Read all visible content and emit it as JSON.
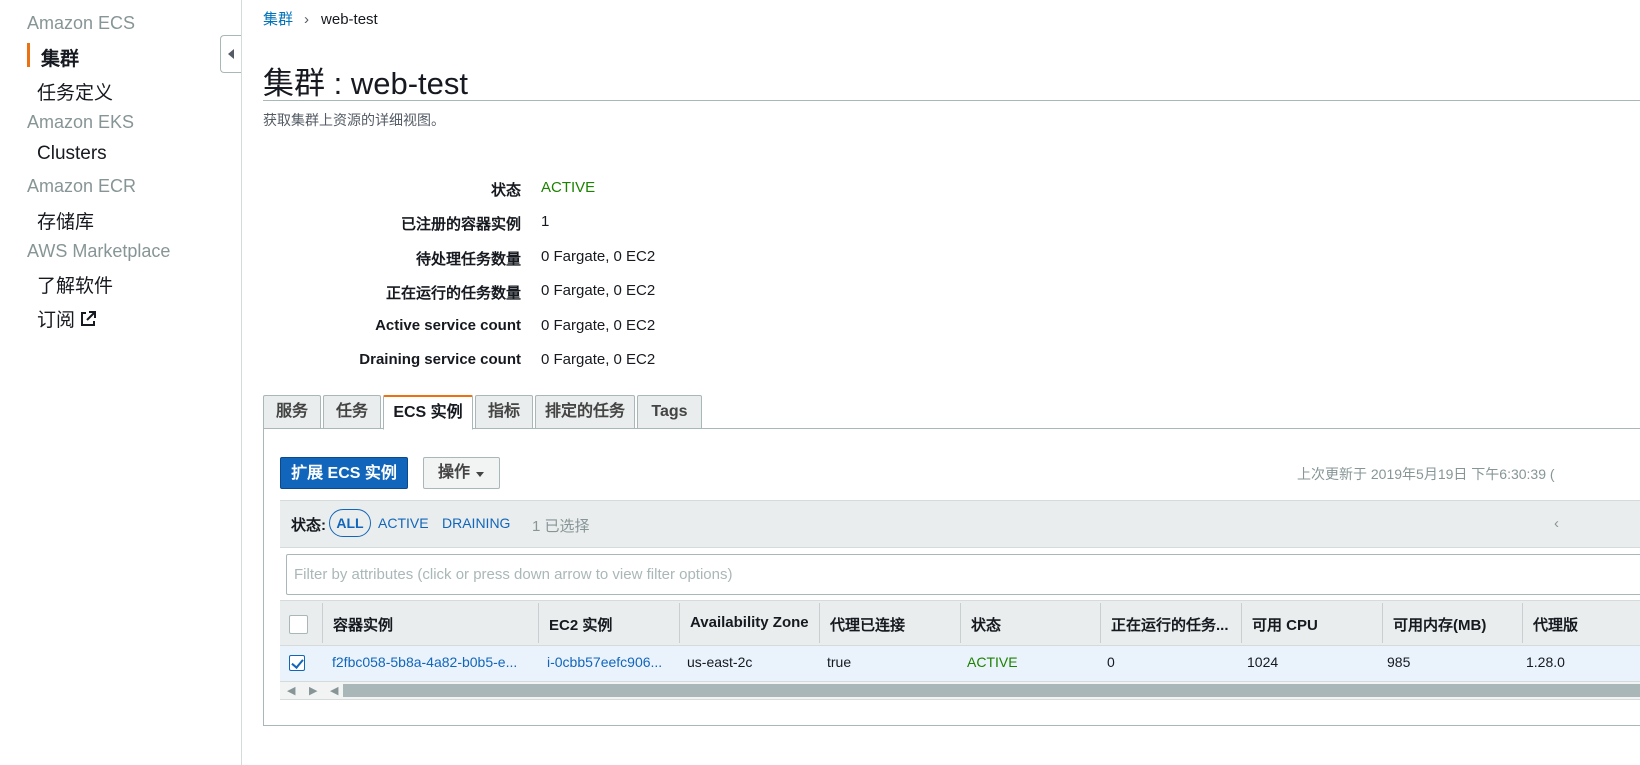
{
  "sidebar": {
    "sections": [
      {
        "title": "Amazon ECS",
        "items": [
          "集群",
          "任务定义"
        ]
      },
      {
        "title": "Amazon EKS",
        "items": [
          "Clusters"
        ]
      },
      {
        "title": "Amazon ECR",
        "items": [
          "存储库"
        ]
      },
      {
        "title": "AWS Marketplace",
        "items": [
          "了解软件",
          "订阅"
        ]
      }
    ],
    "active_item": "集群",
    "external_link_icon": "external-link-icon"
  },
  "breadcrumb": {
    "root": "集群",
    "current": "web-test"
  },
  "page": {
    "title": "集群 : web-test",
    "subtitle": "获取集群上资源的详细视图。"
  },
  "details": [
    {
      "label": "状态",
      "value": "ACTIVE"
    },
    {
      "label": "已注册的容器实例",
      "value": "1"
    },
    {
      "label": "待处理任务数量",
      "value": "0 Fargate, 0 EC2"
    },
    {
      "label": "正在运行的任务数量",
      "value": "0 Fargate, 0 EC2"
    },
    {
      "label": "Active service count",
      "value": "0 Fargate, 0 EC2"
    },
    {
      "label": "Draining service count",
      "value": "0 Fargate, 0 EC2"
    }
  ],
  "tabs": [
    {
      "label": "服务"
    },
    {
      "label": "任务"
    },
    {
      "label": "ECS 实例"
    },
    {
      "label": "指标"
    },
    {
      "label": "排定的任务"
    },
    {
      "label": "Tags"
    }
  ],
  "selected_tab": "ECS 实例",
  "toolbar": {
    "scale_button": "扩展 ECS 实例",
    "actions_button": "操作",
    "last_updated": "上次更新于 2019年5月19日 下午6:30:39 ("
  },
  "filters": {
    "label": "状态:",
    "options": [
      "ALL",
      "ACTIVE",
      "DRAINING"
    ],
    "selected": "ALL",
    "selected_count": "1 已选择",
    "prev_icon": "‹"
  },
  "search": {
    "placeholder": "Filter by attributes (click or press down arrow to view filter options)",
    "value": ""
  },
  "table": {
    "columns": [
      "容器实例",
      "EC2 实例",
      "Availability Zone",
      "代理已连接",
      "状态",
      "正在运行的任务...",
      "可用 CPU",
      "可用内存(MB)",
      "代理版"
    ],
    "rows": [
      {
        "checked": true,
        "cells": [
          "f2fbc058-5b8a-4a82-b0b5-e...",
          "i-0cbb57eefc906...",
          "us-east-2c",
          "true",
          "ACTIVE",
          "0",
          "1024",
          "985",
          "1.28.0"
        ]
      }
    ]
  },
  "colors": {
    "accent": "#ec7211",
    "link": "#1166bb",
    "active_green": "#1d8102"
  }
}
